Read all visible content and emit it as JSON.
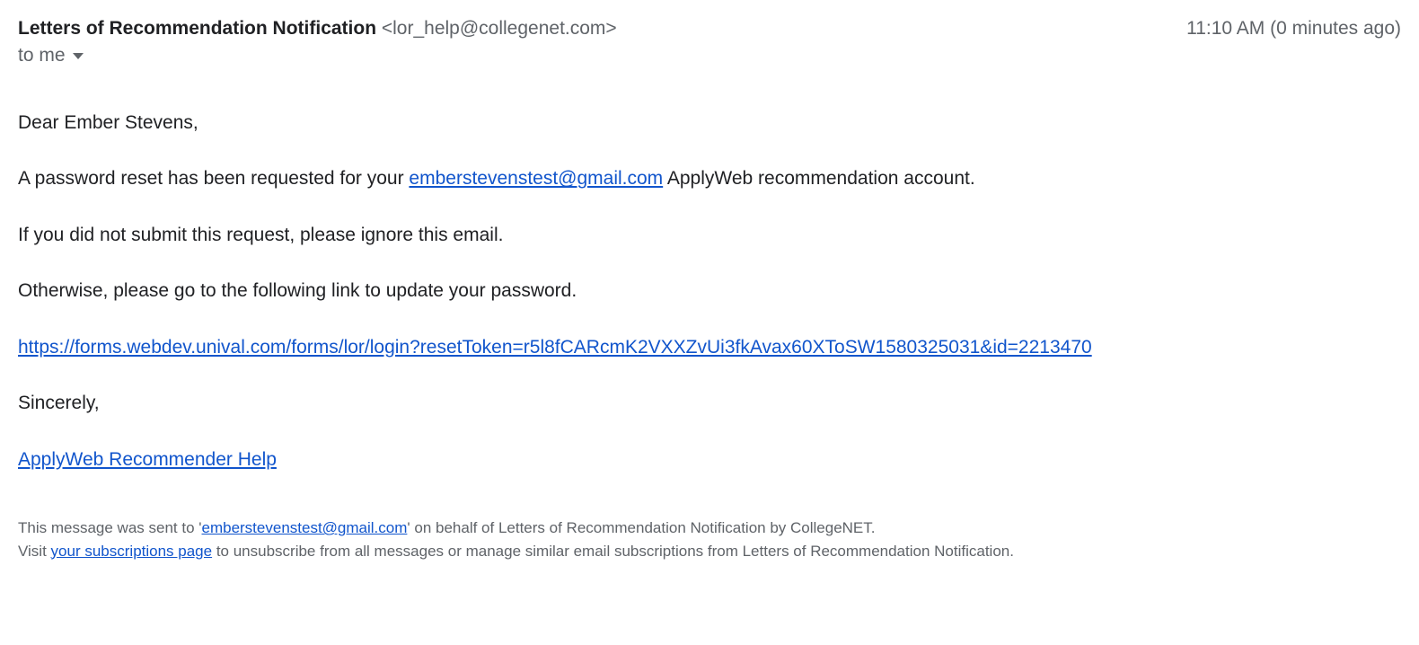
{
  "header": {
    "sender_name": "Letters of Recommendation Notification",
    "sender_email": "<lor_help@collegenet.com>",
    "timestamp": "11:10 AM (0 minutes ago)",
    "recipient": "to me"
  },
  "body": {
    "greeting": "Dear Ember Stevens,",
    "para1_before": "A password reset has been requested for your ",
    "para1_link": "emberstevenstest@gmail.com",
    "para1_after": " ApplyWeb recommendation account.",
    "para2": "If you did not submit this request, please ignore this email.",
    "para3": "Otherwise, please go to the following link to update your password.",
    "reset_link": "https://forms.webdev.unival.com/forms/lor/login?resetToken=r5l8fCARcmK2VXXZvUi3fkAvax60XToSW1580325031&id=2213470",
    "closing": "Sincerely,",
    "signature_link": "ApplyWeb Recommender Help"
  },
  "footer": {
    "line1_before": "This message was sent to '",
    "line1_link": "emberstevenstest@gmail.com",
    "line1_after": "' on behalf of Letters of Recommendation Notification by CollegeNET.",
    "line2_before": "Visit ",
    "line2_link": "your subscriptions page",
    "line2_after": " to unsubscribe from all messages or manage similar email subscriptions from Letters of Recommendation Notification."
  }
}
